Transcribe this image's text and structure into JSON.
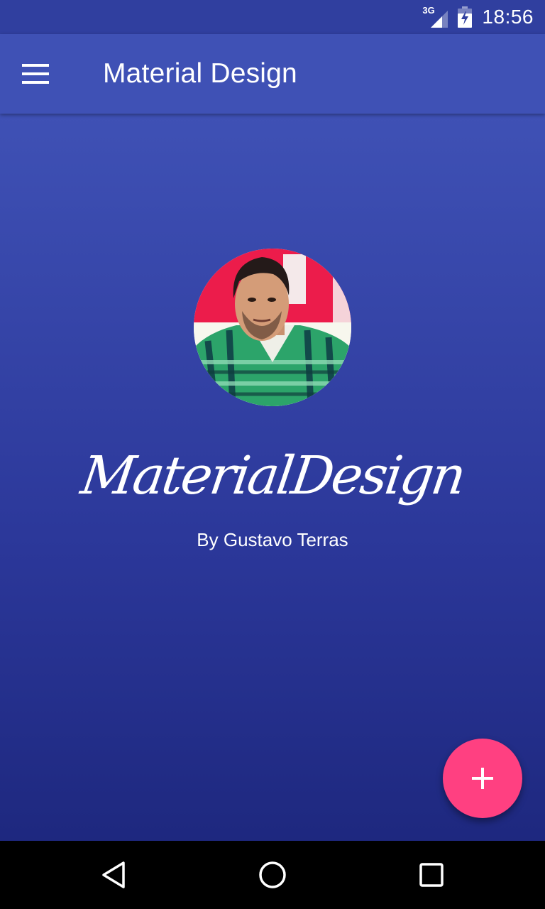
{
  "status_bar": {
    "network_label": "3G",
    "time": "18:56",
    "icons": [
      "signal-icon",
      "battery-charging-icon"
    ]
  },
  "app_bar": {
    "title": "Material Design",
    "menu_icon": "hamburger-menu-icon"
  },
  "profile": {
    "avatar_icon": "profile-photo",
    "script_title": "MaterialDesign",
    "byline": "By Gustavo Terras"
  },
  "fab": {
    "icon": "plus-icon"
  },
  "nav_bar": {
    "icons": [
      "back-icon",
      "home-icon",
      "recents-icon"
    ]
  },
  "colors": {
    "status_bar": "#303f9f",
    "primary": "#3f51b5",
    "accent": "#ff4081",
    "nav_bar": "#000000"
  }
}
